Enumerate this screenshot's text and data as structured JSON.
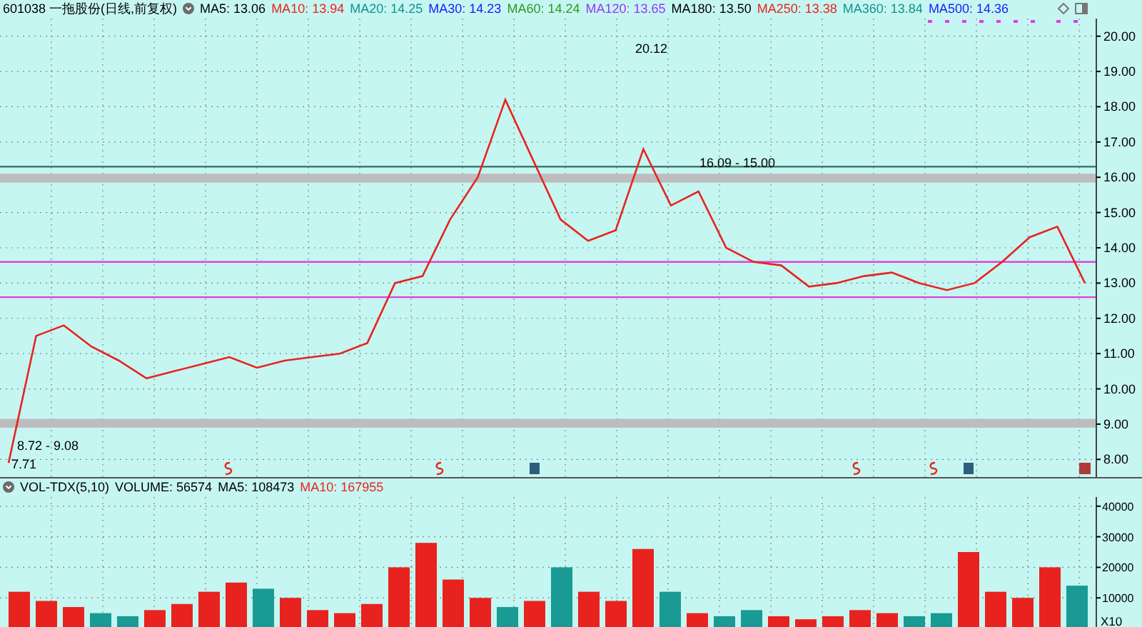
{
  "price_panel": {
    "title": "601038 一拖股份(日线,前复权)",
    "indicators": [
      {
        "text": "MA5: 13.06",
        "color": "#000000"
      },
      {
        "text": "MA10: 13.94",
        "color": "#e8231f"
      },
      {
        "text": "MA20: 14.25",
        "color": "#12928f"
      },
      {
        "text": "MA30: 14.23",
        "color": "#1a1aff"
      },
      {
        "text": "MA60: 14.24",
        "color": "#2e9a20"
      },
      {
        "text": "MA120: 13.65",
        "color": "#9933ff"
      },
      {
        "text": "MA180: 13.50",
        "color": "#000000"
      },
      {
        "text": "MA250: 13.38",
        "color": "#e8231f"
      },
      {
        "text": "MA360: 13.84",
        "color": "#12928f"
      },
      {
        "text": "MA500: 14.36",
        "color": "#1a1aff"
      }
    ],
    "event_markers": [
      {
        "kind": "dividend"
      },
      {
        "kind": "dividend"
      },
      {
        "kind": "report"
      },
      {
        "kind": "dividend"
      },
      {
        "kind": "dividend"
      },
      {
        "kind": "report"
      },
      {
        "kind": "alert"
      }
    ],
    "chart_data": {
      "type": "line",
      "grid": true,
      "series": [
        {
          "color": "#e8231f",
          "values": [
            7.9,
            11.5,
            11.8,
            11.2,
            10.8,
            10.3,
            10.5,
            10.7,
            10.9,
            10.6,
            10.8,
            10.9,
            11.0,
            11.3,
            13.0,
            13.2,
            14.8,
            16.0,
            18.2,
            16.5,
            14.8,
            14.2,
            14.5,
            16.8,
            15.2,
            15.6,
            14.0,
            13.6,
            13.5,
            12.9,
            13.0,
            13.2,
            13.3,
            13.0,
            12.8,
            13.0,
            13.6,
            14.3,
            14.6,
            13.0
          ]
        }
      ],
      "ylim": [
        7.5,
        20.5
      ],
      "yticks": [
        {
          "value": 8,
          "label": "8.00"
        },
        {
          "value": 9,
          "label": "9.00"
        },
        {
          "value": 10,
          "label": "10.00"
        },
        {
          "value": 11,
          "label": "11.00"
        },
        {
          "value": 12,
          "label": "12.00"
        },
        {
          "value": 13,
          "label": "13.00"
        },
        {
          "value": 14,
          "label": "14.00"
        },
        {
          "value": 15,
          "label": "15.00"
        },
        {
          "value": 16,
          "label": "16.00"
        },
        {
          "value": 17,
          "label": "17.00"
        },
        {
          "value": 18,
          "label": "18.00"
        },
        {
          "value": 19,
          "label": "19.00"
        },
        {
          "value": 20,
          "label": "20.00"
        }
      ],
      "ref_lines": [
        {
          "axis": "y",
          "value": 16.3,
          "color": "#2f6f5f"
        },
        {
          "axis": "y",
          "value": 13.6,
          "color": "#e040e0"
        },
        {
          "axis": "y",
          "value": 12.6,
          "color": "#e040e0"
        }
      ],
      "bands": [
        {
          "axis": "y",
          "from": 15.85,
          "to": 16.1
        },
        {
          "axis": "y",
          "from": 8.9,
          "to": 9.15
        }
      ],
      "annotations": [
        "20.12",
        "16.09 - 15.00",
        "8.72 - 9.08",
        "7.71"
      ]
    }
  },
  "volume_panel": {
    "title": "VOL-TDX(5,10)",
    "indicators": [
      {
        "text": "VOLUME: 56574",
        "color": "#000000"
      },
      {
        "text": "MA5: 108473",
        "color": "#000000"
      },
      {
        "text": "MA10: 167955",
        "color": "#e8231f"
      }
    ],
    "unit": "X10",
    "chart_data": {
      "type": "bar",
      "grid": true,
      "series": [
        {
          "color": "#e8231f",
          "values": [
            12000,
            9000,
            7000,
            null,
            null,
            6000,
            8000,
            12000,
            15000,
            null,
            10000,
            6000,
            5000,
            8000,
            20000,
            28000,
            16000,
            10000,
            null,
            9000,
            null,
            12000,
            9000,
            26000,
            null,
            5000,
            null,
            null,
            4000,
            3000,
            4000,
            6000,
            5000,
            null,
            null,
            25000,
            12000,
            10000,
            20000,
            null
          ]
        },
        {
          "color": "#1a9a94",
          "values": [
            null,
            null,
            null,
            5000,
            4000,
            null,
            null,
            null,
            null,
            13000,
            null,
            null,
            null,
            null,
            null,
            null,
            null,
            null,
            7000,
            null,
            20000,
            null,
            null,
            null,
            12000,
            null,
            4000,
            6000,
            null,
            null,
            null,
            null,
            null,
            4000,
            5000,
            null,
            null,
            null,
            null,
            14000
          ]
        }
      ],
      "ylim": [
        0,
        43000
      ],
      "yticks": [
        {
          "value": 10000,
          "label": "10000"
        },
        {
          "value": 20000,
          "label": "20000"
        },
        {
          "value": 30000,
          "label": "30000"
        },
        {
          "value": 40000,
          "label": "40000"
        }
      ]
    }
  }
}
